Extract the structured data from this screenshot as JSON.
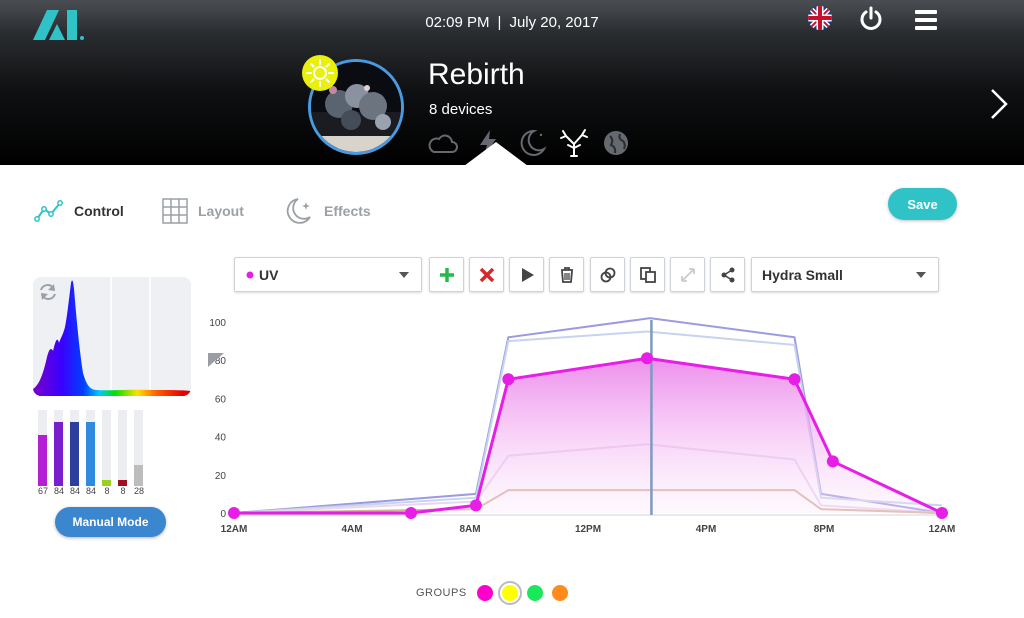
{
  "header": {
    "logo_text": "AI",
    "time": "02:09 PM",
    "separator": "|",
    "date": "July 20, 2017",
    "tank_name": "Rebirth",
    "device_count": "8 devices",
    "icons": [
      "logo-icon",
      "flag-icon",
      "power-icon",
      "menu-icon",
      "sun-icon",
      "cloud-icon",
      "lightning-icon",
      "moon-icon",
      "coral-icon",
      "globe-icon",
      "chevron-right-icon"
    ],
    "colors": {
      "accent_blue": "#4a9ae0",
      "sun_yellow": "#e8f00c",
      "logo_teal": "#2fc3c8"
    }
  },
  "tabs": [
    {
      "label": "Control",
      "active": true,
      "icon": "line-graph-icon"
    },
    {
      "label": "Layout",
      "active": false,
      "icon": "grid-icon"
    },
    {
      "label": "Effects",
      "active": false,
      "icon": "moon-stars-icon"
    }
  ],
  "save_label": "Save",
  "channels": [
    {
      "value": "67",
      "level": 67,
      "color": "#b51fd4"
    },
    {
      "value": "84",
      "level": 84,
      "color": "#7a1fcc"
    },
    {
      "value": "84",
      "level": 84,
      "color": "#2d3f9e"
    },
    {
      "value": "84",
      "level": 84,
      "color": "#2f8ae0"
    },
    {
      "value": "8",
      "level": 8,
      "color": "#9ad020"
    },
    {
      "value": "8",
      "level": 8,
      "color": "#a01020"
    },
    {
      "value": "28",
      "level": 28,
      "color": "#bdbdbd"
    }
  ],
  "manual_mode_label": "Manual Mode",
  "toolbar": {
    "channel_select": "UV",
    "channel_dot_color": "#e61ee6",
    "fixture_select": "Hydra Small",
    "buttons": [
      "add-icon",
      "delete-icon",
      "play-icon",
      "trash-icon",
      "link-icon",
      "copy-icon",
      "expand-icon",
      "share-icon"
    ]
  },
  "chart_data": {
    "type": "line",
    "y_ticks": [
      "100",
      "80",
      "60",
      "40",
      "20",
      "0"
    ],
    "x_ticks": [
      "12AM",
      "4AM",
      "8AM",
      "12PM",
      "4PM",
      "8PM",
      "12AM"
    ],
    "ylim": [
      0,
      100
    ],
    "xlim": [
      0,
      24
    ],
    "current_time_hour": 14.15,
    "series": [
      {
        "role": "active",
        "points": [
          [
            0,
            0
          ],
          [
            6,
            0
          ],
          [
            8.2,
            4
          ],
          [
            9.3,
            70
          ],
          [
            14,
            81
          ],
          [
            19,
            70
          ],
          [
            20.3,
            27
          ],
          [
            24,
            0
          ]
        ],
        "color": "#e61ee6"
      },
      {
        "role": "reference",
        "points": [
          [
            0,
            0
          ],
          [
            8.2,
            10
          ],
          [
            9.3,
            92
          ],
          [
            14.1,
            102
          ],
          [
            19,
            92
          ],
          [
            19.9,
            10
          ],
          [
            24,
            0
          ]
        ],
        "color": "#9c9ae0"
      },
      {
        "role": "reference",
        "points": [
          [
            0,
            0
          ],
          [
            8.2,
            8
          ],
          [
            9.3,
            90
          ],
          [
            14,
            95
          ],
          [
            19,
            88
          ],
          [
            19.9,
            8
          ],
          [
            24,
            4
          ]
        ],
        "color": "#c6d4f0"
      },
      {
        "role": "reference",
        "points": [
          [
            0,
            0
          ],
          [
            8.2,
            6
          ],
          [
            9.3,
            30
          ],
          [
            14,
            36
          ],
          [
            19,
            28
          ],
          [
            19.9,
            4
          ],
          [
            24,
            0
          ]
        ],
        "color": "#e8d6ee"
      },
      {
        "role": "reference",
        "points": [
          [
            0,
            0
          ],
          [
            8.2,
            2
          ],
          [
            9.3,
            12
          ],
          [
            14,
            12
          ],
          [
            19,
            12
          ],
          [
            19.9,
            2
          ],
          [
            24,
            0
          ]
        ],
        "color": "#d8b09a"
      }
    ]
  },
  "groups": {
    "label": "GROUPS",
    "items": [
      {
        "color": "#ff00cc",
        "selected": false
      },
      {
        "color": "#ffff00",
        "selected": true
      },
      {
        "color": "#19e85a",
        "selected": false
      },
      {
        "color": "#ff8c1a",
        "selected": false
      }
    ]
  }
}
